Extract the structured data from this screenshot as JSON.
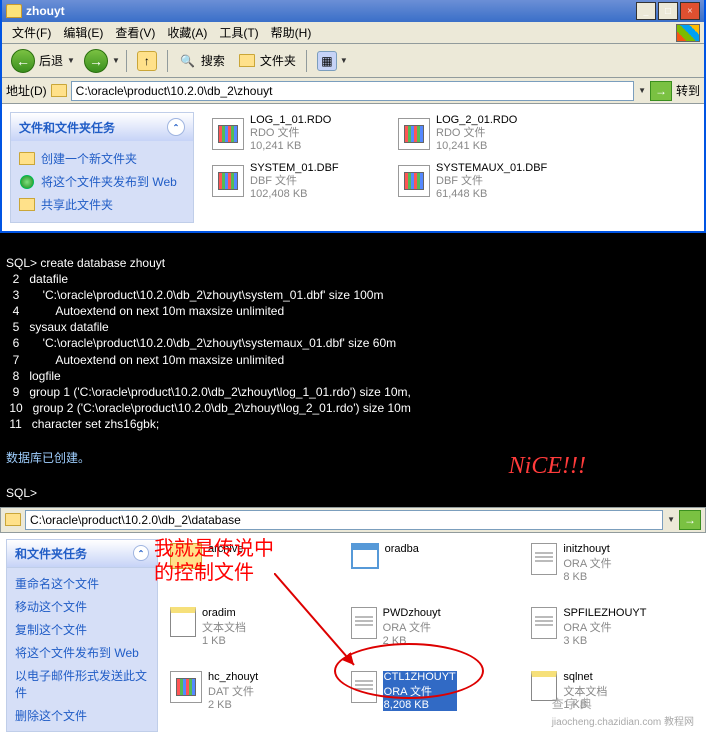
{
  "window": {
    "title": "zhouyt",
    "buttons": {
      "min": "_",
      "max": "□",
      "close": "×"
    },
    "menu": [
      "文件(F)",
      "编辑(E)",
      "查看(V)",
      "收藏(A)",
      "工具(T)",
      "帮助(H)"
    ],
    "toolbar": {
      "back": "后退",
      "search": "搜索",
      "folders": "文件夹"
    },
    "address_label": "地址(D)",
    "address_value": "C:\\oracle\\product\\10.2.0\\db_2\\zhouyt",
    "go": "转到",
    "side": {
      "header": "文件和文件夹任务",
      "links": {
        "new_folder": "创建一个新文件夹",
        "publish": "将这个文件夹发布到 Web",
        "share": "共享此文件夹"
      }
    },
    "files": [
      {
        "name": "LOG_1_01.RDO",
        "type": "RDO 文件",
        "size": "10,241 KB"
      },
      {
        "name": "LOG_2_01.RDO",
        "type": "RDO 文件",
        "size": "10,241 KB"
      },
      {
        "name": "SYSTEM_01.DBF",
        "type": "DBF 文件",
        "size": "102,408 KB"
      },
      {
        "name": "SYSTEMAUX_01.DBF",
        "type": "DBF 文件",
        "size": "61,448 KB"
      }
    ]
  },
  "terminal": {
    "lines": [
      "SQL> create database zhouyt",
      "  2   datafile",
      "  3       'C:\\oracle\\product\\10.2.0\\db_2\\zhouyt\\system_01.dbf' size 100m",
      "  4           Autoextend on next 10m maxsize unlimited",
      "  5   sysaux datafile",
      "  6       'C:\\oracle\\product\\10.2.0\\db_2\\zhouyt\\systemaux_01.dbf' size 60m",
      "  7           Autoextend on next 10m maxsize unlimited",
      "  8   logfile",
      "  9   group 1 ('C:\\oracle\\product\\10.2.0\\db_2\\zhouyt\\log_1_01.rdo') size 10m,",
      " 10   group 2 ('C:\\oracle\\product\\10.2.0\\db_2\\zhouyt\\log_2_01.rdo') size 10m",
      " 11   character set zhs16gbk;"
    ],
    "result": "数据库已创建。",
    "prompt": "SQL>",
    "nice": "NiCE!!!"
  },
  "lower": {
    "address_value": "C:\\oracle\\product\\10.2.0\\db_2\\database",
    "side_header": "和文件夹任务",
    "side_links": [
      "重命名这个文件",
      "移动这个文件",
      "复制这个文件",
      "将这个文件发布到 Web",
      "以电子邮件形式发送此文件",
      "删除这个文件"
    ],
    "annotation": "我就是传说中\n的控制文件",
    "files": [
      {
        "name": "archive",
        "type": "",
        "size": "",
        "icon": "folder"
      },
      {
        "name": "oradba",
        "type": "",
        "size": "",
        "icon": "win"
      },
      {
        "name": "initzhouyt",
        "type": "ORA 文件",
        "size": "8 KB",
        "icon": "page"
      },
      {
        "name": "oradim",
        "type": "文本文档",
        "size": "1 KB",
        "icon": "notepad"
      },
      {
        "name": "PWDzhouyt",
        "type": "ORA 文件",
        "size": "2 KB",
        "icon": "page"
      },
      {
        "name": "SPFILEZHOUYT",
        "type": "ORA 文件",
        "size": "3 KB",
        "icon": "page"
      },
      {
        "name": "hc_zhouyt",
        "type": "DAT 文件",
        "size": "2 KB",
        "icon": "data"
      },
      {
        "name": "CTL1ZHOUYT",
        "type": "ORA 文件",
        "size": "8,208 KB",
        "icon": "page",
        "selected": true
      },
      {
        "name": "sqlnet",
        "type": "文本文档",
        "size": "1 KB",
        "icon": "notepad"
      }
    ],
    "watermark": {
      "main": "查字典",
      "sub": "jiaocheng.chazidian.com 教程网"
    }
  }
}
